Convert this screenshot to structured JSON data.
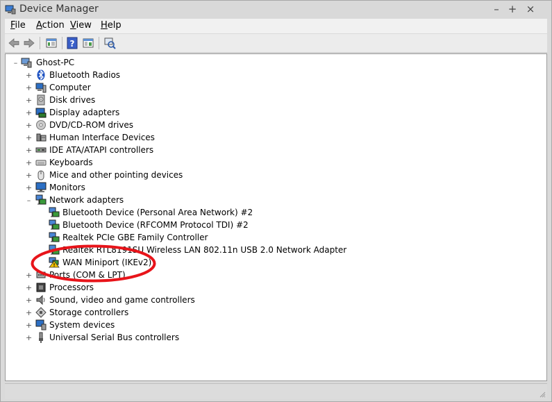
{
  "window": {
    "title": "Device Manager",
    "controls": {
      "minimize": "–",
      "maximize": "+",
      "close": "×"
    }
  },
  "menu": [
    {
      "label": "File",
      "accel": "F"
    },
    {
      "label": "Action",
      "accel": "A"
    },
    {
      "label": "View",
      "accel": "V"
    },
    {
      "label": "Help",
      "accel": "H"
    }
  ],
  "tree": {
    "root": "Ghost-PC",
    "categories": [
      {
        "label": "Bluetooth Radios",
        "icon": "bluetooth-icon"
      },
      {
        "label": "Computer",
        "icon": "computer-icon"
      },
      {
        "label": "Disk drives",
        "icon": "disk-drive-icon"
      },
      {
        "label": "Display adapters",
        "icon": "display-adapter-icon"
      },
      {
        "label": "DVD/CD-ROM drives",
        "icon": "optical-drive-icon"
      },
      {
        "label": "Human Interface Devices",
        "icon": "hid-icon"
      },
      {
        "label": "IDE ATA/ATAPI controllers",
        "icon": "ide-controller-icon"
      },
      {
        "label": "Keyboards",
        "icon": "keyboard-icon"
      },
      {
        "label": "Mice and other pointing devices",
        "icon": "mouse-icon"
      },
      {
        "label": "Monitors",
        "icon": "monitor-icon"
      },
      {
        "label": "Network adapters",
        "icon": "network-adapter-icon",
        "expanded": true,
        "children": [
          {
            "label": "Bluetooth Device (Personal Area Network) #2",
            "icon": "network-adapter-icon"
          },
          {
            "label": "Bluetooth Device (RFCOMM Protocol TDI) #2",
            "icon": "network-adapter-icon"
          },
          {
            "label": "Realtek PCIe GBE Family Controller",
            "icon": "network-adapter-icon"
          },
          {
            "label": "Realtek RTL8191SU Wireless LAN 802.11n USB 2.0 Network Adapter",
            "icon": "network-adapter-icon"
          },
          {
            "label": "WAN Miniport (IKEv2)",
            "icon": "warning-icon",
            "warning": true
          }
        ]
      },
      {
        "label": "Ports (COM & LPT)",
        "icon": "port-icon"
      },
      {
        "label": "Processors",
        "icon": "processor-icon"
      },
      {
        "label": "Sound, video and game controllers",
        "icon": "speaker-icon"
      },
      {
        "label": "Storage controllers",
        "icon": "storage-controller-icon"
      },
      {
        "label": "System devices",
        "icon": "system-devices-icon"
      },
      {
        "label": "Universal Serial Bus controllers",
        "icon": "usb-icon"
      }
    ]
  },
  "colors": {
    "highlight_ellipse": "#e8141a",
    "icon_blue": "#2c6fc4",
    "warning": "#f2c200"
  }
}
